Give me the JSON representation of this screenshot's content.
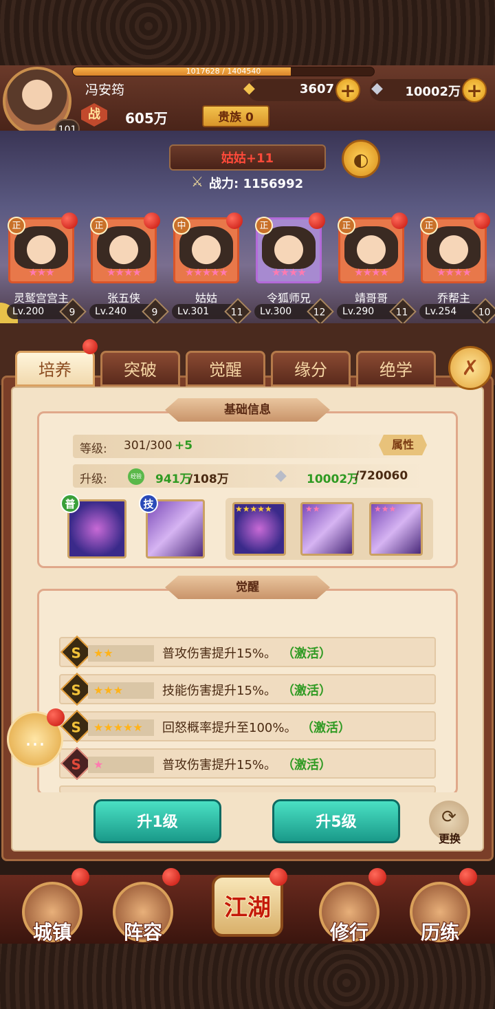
{
  "player": {
    "name": "冯安筠",
    "level": "101",
    "exp_text": "1017628 / 1404540",
    "exp_fraction": 0.7245,
    "power_label": "战",
    "power": "605万",
    "noble": "贵族 0"
  },
  "currency": {
    "gold": "3607",
    "silver": "10002万",
    "plus": "+"
  },
  "scene": {
    "hero_title": "姑姑+11",
    "combat_power": "战力: 1156992"
  },
  "heroes": [
    {
      "badge": "正",
      "name": "灵鹫宫宫主",
      "level": "Lv.200",
      "stage": "9",
      "stars": "★★★",
      "frame": "orange"
    },
    {
      "badge": "正",
      "name": "张五侠",
      "level": "Lv.240",
      "stage": "9",
      "stars": "★★★★",
      "frame": "orange"
    },
    {
      "badge": "中",
      "name": "姑姑",
      "level": "Lv.301",
      "stage": "11",
      "stars": "★★★★★",
      "frame": "orange"
    },
    {
      "badge": "正",
      "name": "令狐师兄",
      "level": "Lv.300",
      "stage": "12",
      "stars": "★★★★",
      "frame": "purple"
    },
    {
      "badge": "正",
      "name": "靖哥哥",
      "level": "Lv.290",
      "stage": "11",
      "stars": "★★★★",
      "frame": "orange"
    },
    {
      "badge": "正",
      "name": "乔帮主",
      "level": "Lv.254",
      "stage": "10",
      "stars": "★★★★",
      "frame": "orange"
    }
  ],
  "tabs": [
    "培养",
    "突破",
    "觉醒",
    "缘分",
    "绝学"
  ],
  "basic_info": {
    "title": "基础信息",
    "level_label": "等级:",
    "level_value": "301/300",
    "level_bonus": "+5",
    "attr_button": "属性",
    "upgrade_label": "升级:",
    "exp_icon": "经验",
    "exp_have": "941万",
    "exp_need": "/108万",
    "silver_have": "10002万",
    "silver_need": "/720060",
    "skill_tag_normal": "普",
    "skill_tag_skill": "技",
    "skill_stars": [
      "★★★★★",
      "★★",
      "★★★"
    ]
  },
  "awaken": {
    "title": "觉醒",
    "rows": [
      {
        "stars": "★★",
        "text": "普攻伤害提升15%。",
        "status": "（激活）",
        "color": "gold"
      },
      {
        "stars": "★★★",
        "text": "技能伤害提升15%。",
        "status": "（激活）",
        "color": "gold"
      },
      {
        "stars": "★★★★★",
        "text": "回怒概率提升至100%。",
        "status": "（激活）",
        "color": "gold"
      },
      {
        "stars": "★",
        "text": "普攻伤害提升15%。",
        "status": "（激活）",
        "color": "pink"
      }
    ]
  },
  "buttons": {
    "up1": "升1级",
    "up5": "升5级",
    "swap": "更换"
  },
  "nav": [
    "城镇",
    "阵容",
    "江湖",
    "修行",
    "历练"
  ],
  "colors": {
    "accent_gold": "#f3c24d",
    "active_green": "#2f9a22",
    "hero_name_red": "#ff4a3a",
    "button_teal": "#1a9a8a"
  }
}
